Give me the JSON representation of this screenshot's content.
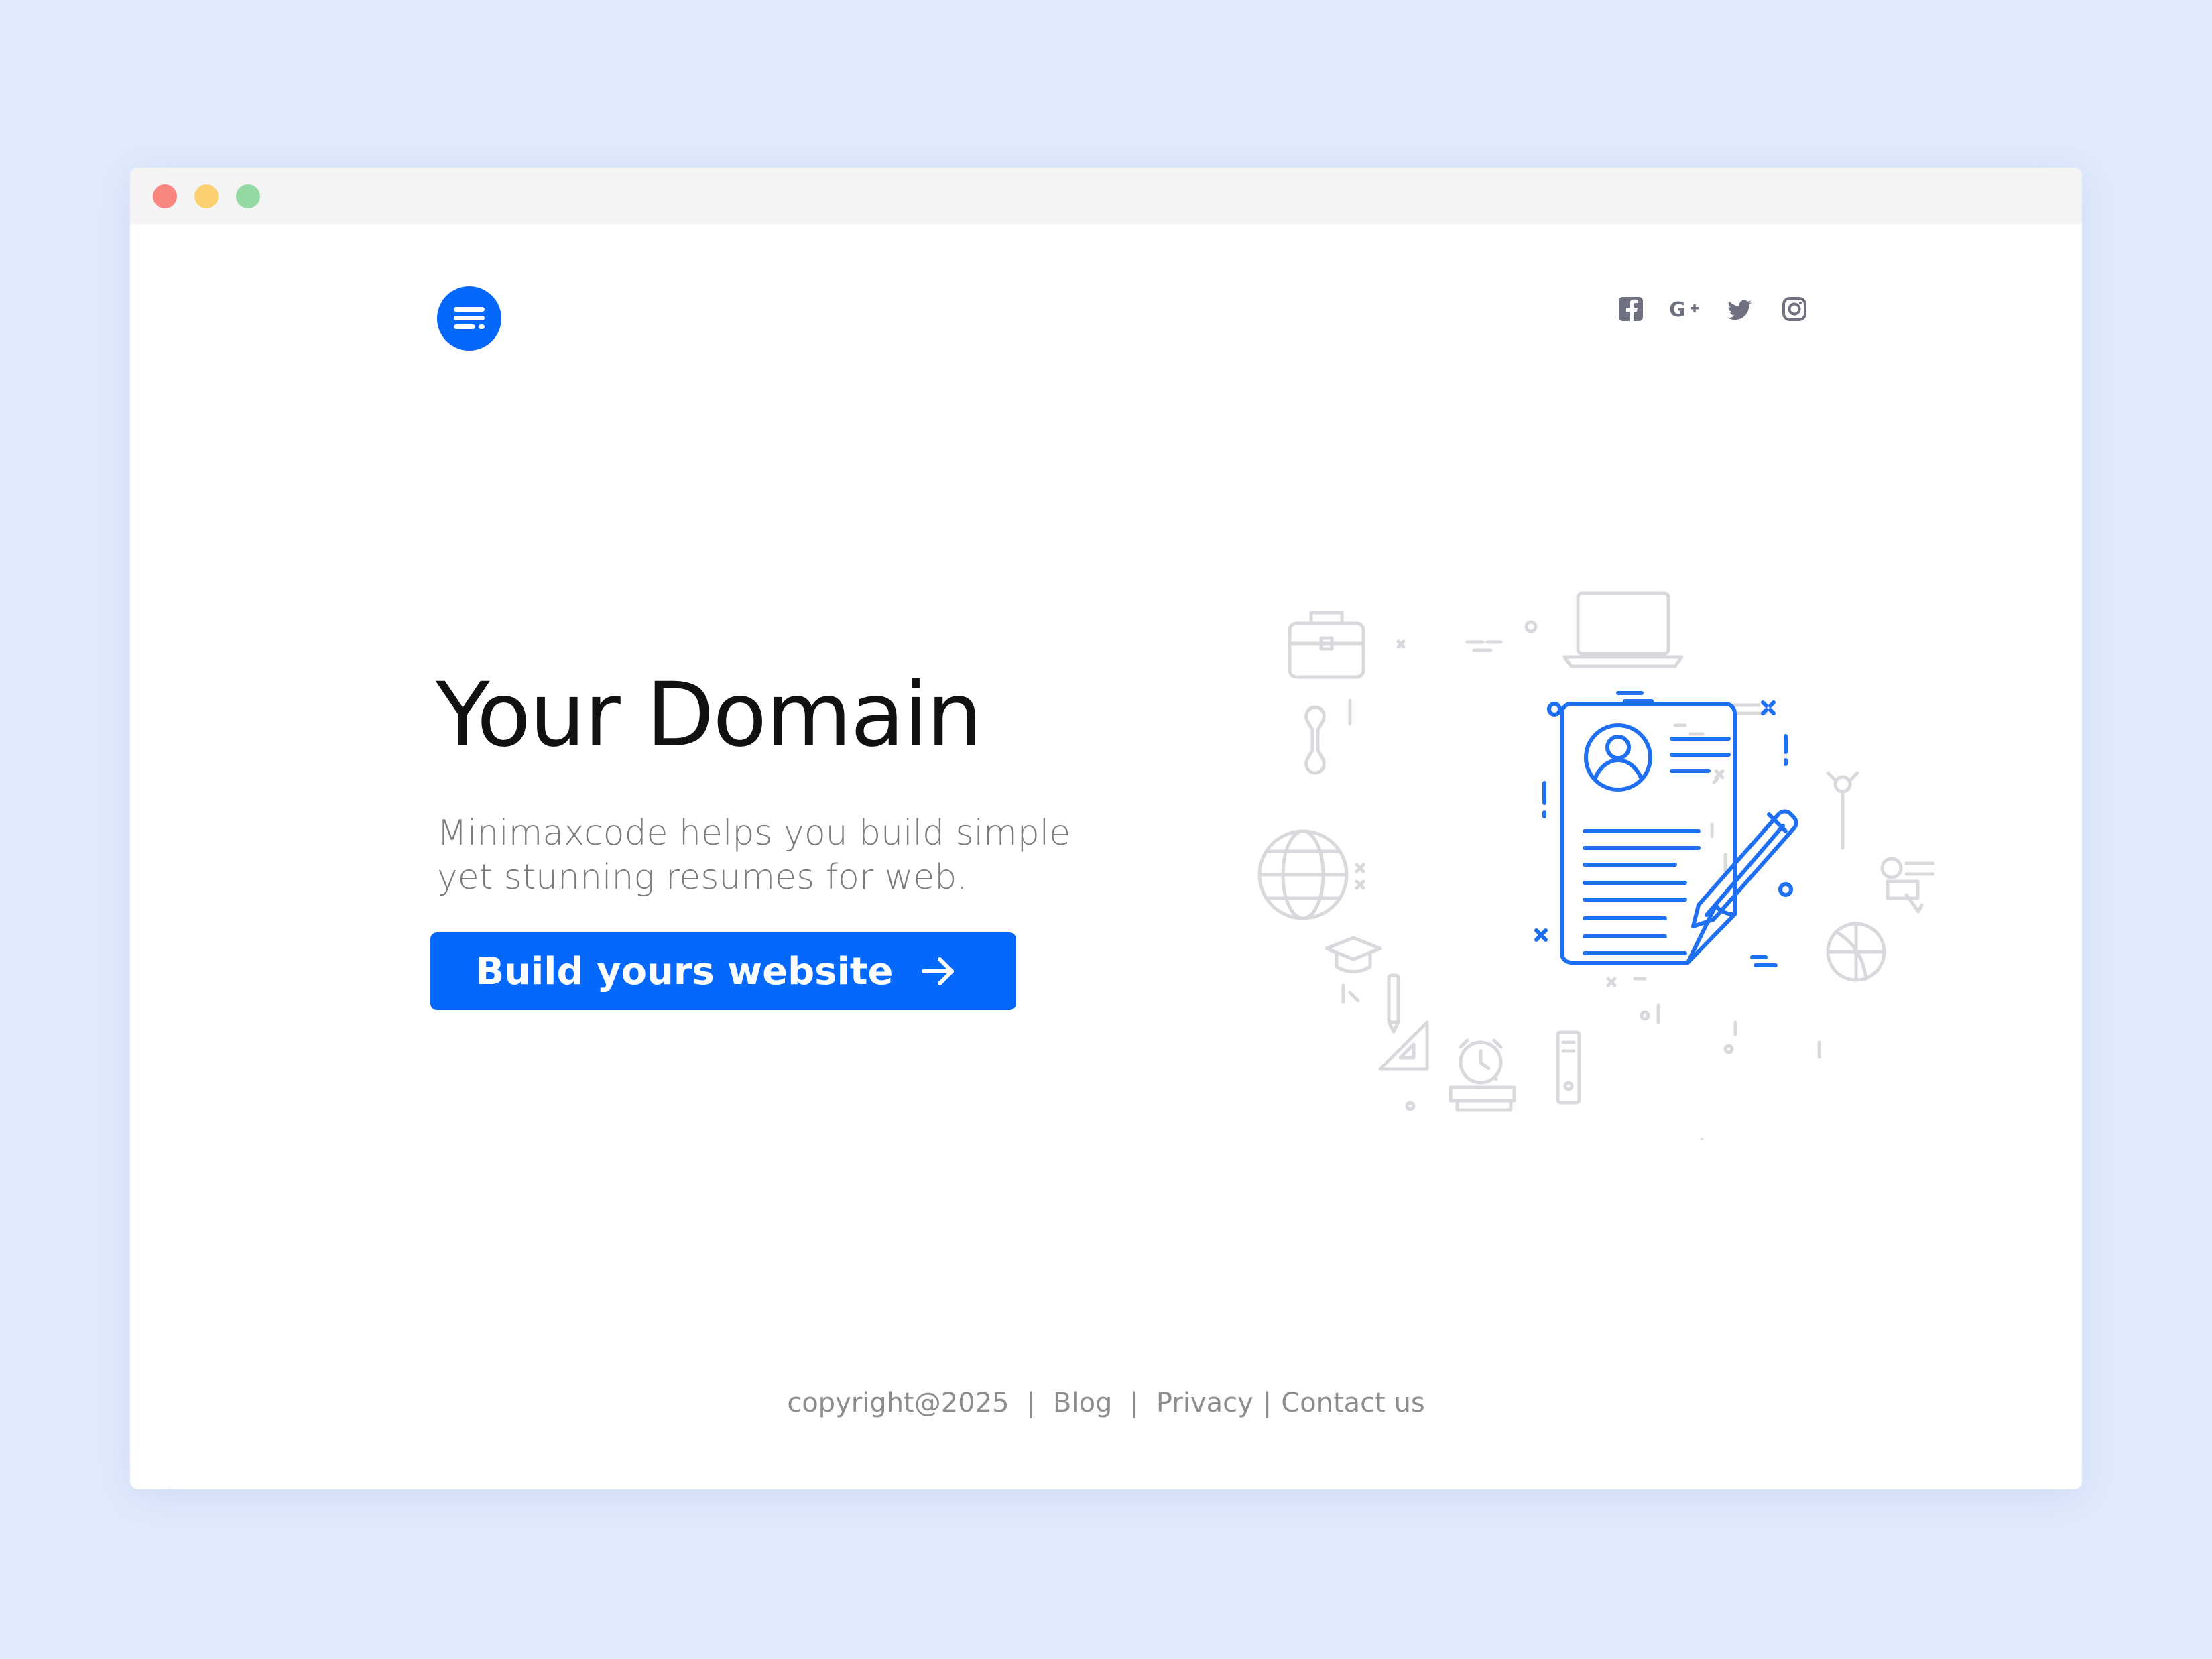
{
  "colors": {
    "page_background": "#e2ebfd",
    "window_background": "#ffffff",
    "titlebar": "#f4f4f4",
    "accent": "#0568fd",
    "traffic_red": "#f9877f",
    "traffic_yellow": "#fbd071",
    "traffic_green": "#94d8a3",
    "social_icon": "#6f7180",
    "muted_text": "#8d8d8d",
    "illustration_line": "#1e6ff2",
    "illustration_faint": "#d7d9dd"
  },
  "header": {
    "logo_icon": "menu-lines-icon",
    "social": [
      {
        "name": "facebook",
        "icon": "facebook-icon"
      },
      {
        "name": "google-plus",
        "icon": "google-plus-icon"
      },
      {
        "name": "twitter",
        "icon": "twitter-icon"
      },
      {
        "name": "instagram",
        "icon": "instagram-icon"
      }
    ]
  },
  "hero": {
    "title": "Your Domain",
    "subtitle": "Minimaxcode helps you build simple yet stunning resumes for web.",
    "cta_label": "Build yours website",
    "cta_icon": "arrow-right-icon",
    "illustration_icon": "resume-document-icon"
  },
  "footer": {
    "copyright": "copyright@2025",
    "separator": "|",
    "links": [
      {
        "label": "Blog"
      },
      {
        "label": "Privacy"
      },
      {
        "label": "Contact us"
      }
    ]
  }
}
